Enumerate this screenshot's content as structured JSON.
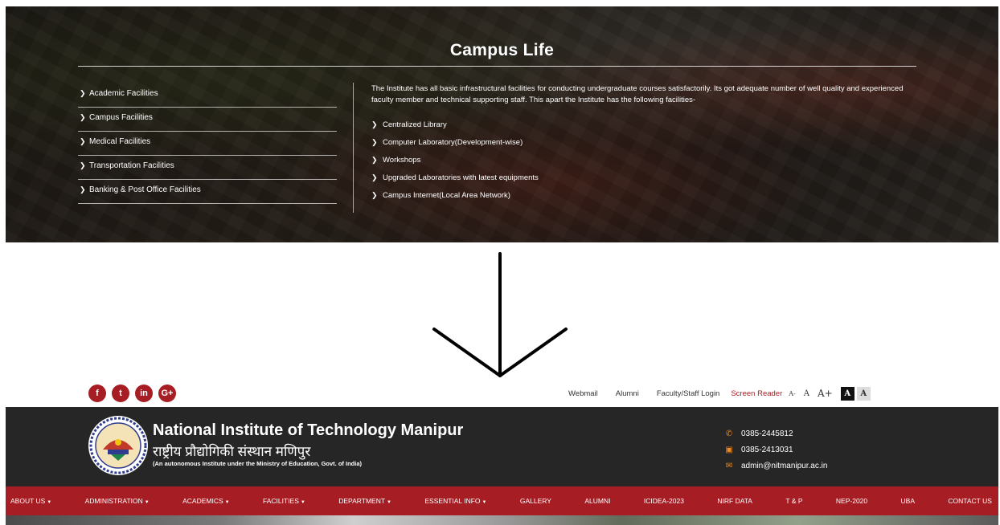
{
  "campus_life": {
    "title": "Campus Life",
    "menu": [
      {
        "label": "Academic Facilities"
      },
      {
        "label": "Campus Facilities"
      },
      {
        "label": "Medical Facilities"
      },
      {
        "label": "Transportation Facilities"
      },
      {
        "label": "Banking & Post Office Facilities"
      }
    ],
    "description": "The Institute has all basic infrastructural facilities for conducting undergraduate courses satisfactorily. Its got adequate number of well quality and experienced faculty member and technical supporting staff. This apart the Institute has the following facilities-",
    "facilities": [
      {
        "label": "Centralized Library"
      },
      {
        "label": "Computer Laboratory(Development-wise)"
      },
      {
        "label": "Workshops"
      },
      {
        "label": "Upgraded Laboratories with latest equipments"
      },
      {
        "label": "Campus Internet(Local Area Network)"
      }
    ]
  },
  "header": {
    "social": [
      {
        "icon": "facebook-icon",
        "glyph": "f"
      },
      {
        "icon": "twitter-icon",
        "glyph": "t"
      },
      {
        "icon": "linkedin-icon",
        "glyph": "in"
      },
      {
        "icon": "google-plus-icon",
        "glyph": "G+"
      }
    ],
    "top_links": {
      "webmail": "Webmail",
      "alumni": "Alumni",
      "faculty_login": "Faculty/Staff Login",
      "screen_reader": "Screen Reader",
      "font_smaller": "A-",
      "font_normal": "A",
      "font_larger": "A+",
      "contrast_dark": "A",
      "contrast_light": "A"
    },
    "institute": {
      "name": "National Institute of Technology Manipur",
      "name_hindi": "राष्ट्रीय प्रौद्योगिकी संस्थान मणिपुर",
      "subtitle": "(An autonomous Institute under the Ministry of Education, Govt. of India)"
    },
    "contacts": {
      "phone1": "0385-2445812",
      "phone2": "0385-2413031",
      "email": "admin@nitmanipur.ac.in"
    },
    "nav": [
      {
        "label": "ABOUT US",
        "dropdown": true
      },
      {
        "label": "ADMINISTRATION",
        "dropdown": true
      },
      {
        "label": "ACADEMICS",
        "dropdown": true
      },
      {
        "label": "FACILITIES",
        "dropdown": true
      },
      {
        "label": "DEPARTMENT",
        "dropdown": true
      },
      {
        "label": "ESSENTIAL INFO",
        "dropdown": true
      },
      {
        "label": "GALLERY",
        "dropdown": false
      },
      {
        "label": "ALUMNI",
        "dropdown": false
      },
      {
        "label": "ICIDEA-2023",
        "dropdown": false
      },
      {
        "label": "NIRF DATA",
        "dropdown": false
      },
      {
        "label": "T & P",
        "dropdown": false
      },
      {
        "label": "NEP-2020",
        "dropdown": false
      },
      {
        "label": "UBA",
        "dropdown": false
      },
      {
        "label": "CONTACT US",
        "dropdown": false
      }
    ]
  },
  "colors": {
    "brand_red": "#a71d24",
    "header_dark": "#262626",
    "contact_icon": "#f28a1c"
  }
}
